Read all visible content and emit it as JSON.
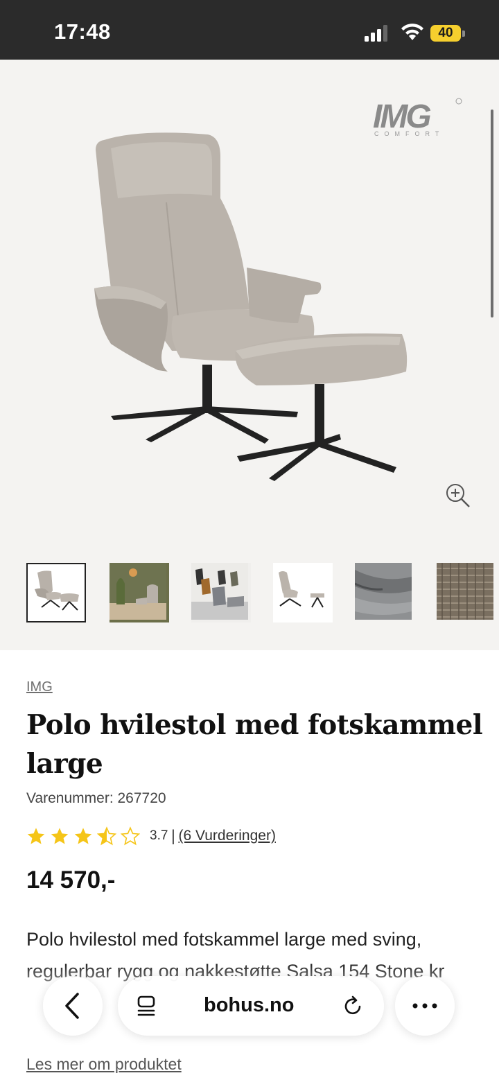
{
  "status_bar": {
    "time": "17:48",
    "battery": "40"
  },
  "gallery": {
    "logo_text": "IMG",
    "logo_subtext": "COMFORT",
    "thumbnails": [
      {
        "name": "thumb-chair-grey"
      },
      {
        "name": "thumb-living-room"
      },
      {
        "name": "thumb-chair-group"
      },
      {
        "name": "thumb-chair-side"
      },
      {
        "name": "thumb-fabric-grey"
      },
      {
        "name": "thumb-fabric-texture"
      }
    ]
  },
  "product": {
    "brand": "IMG",
    "title": "Polo hvilestol med fotskammel large",
    "sku": "Varenummer: 267720",
    "rating": {
      "value": "3.7",
      "separator": "|",
      "count": "(6 Vurderinger)",
      "stars": 3.5
    },
    "price": "14 570,-",
    "description": "Polo hvilestol med fotskammel large med sving, regulerbar rygg og nakkestøtte Salsa 154 Stone kr",
    "read_more": "Les mer om produktet"
  },
  "browser": {
    "url": "bohus.no"
  },
  "colors": {
    "status_bar": "#2b2b2b",
    "gallery_bg": "#f4f3f1",
    "star": "#f5c518",
    "battery": "#f6cf2e"
  }
}
